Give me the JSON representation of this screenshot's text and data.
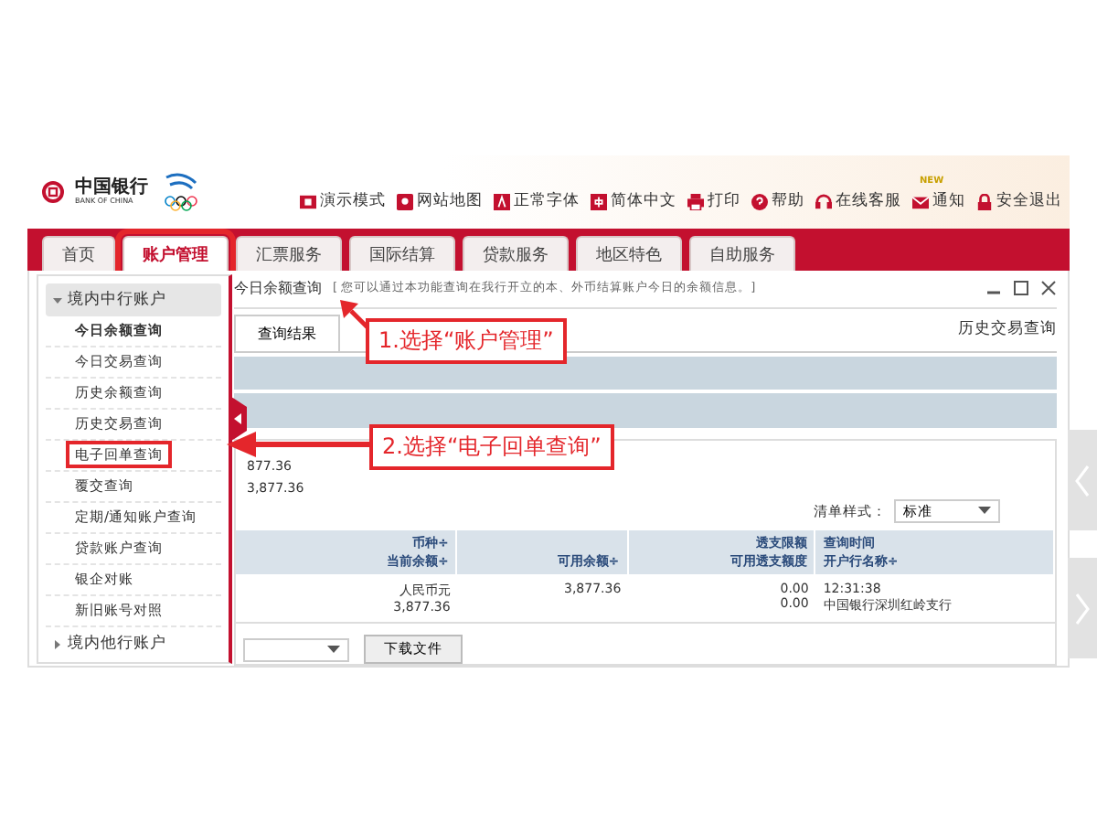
{
  "logo": {
    "name": "中国银行",
    "subtitle": "BANK OF CHINA"
  },
  "toolbar": [
    {
      "label": "演示模式",
      "kind": "demo"
    },
    {
      "label": "网站地图",
      "kind": "map"
    },
    {
      "label": "正常字体",
      "kind": "font"
    },
    {
      "label": "简体中文",
      "kind": "lang"
    },
    {
      "label": "打印",
      "kind": "print"
    },
    {
      "label": "帮助",
      "kind": "help"
    },
    {
      "label": "在线客服",
      "kind": "service"
    },
    {
      "label": "通知",
      "kind": "mail",
      "badge": "NEW"
    },
    {
      "label": "安全退出",
      "kind": "lock"
    }
  ],
  "nav_tabs": [
    {
      "label": "首页",
      "selected": false,
      "highlighted": false
    },
    {
      "label": "账户管理",
      "selected": true,
      "highlighted": true
    },
    {
      "label": "汇票服务",
      "selected": false,
      "highlighted": false
    },
    {
      "label": "国际结算",
      "selected": false,
      "highlighted": false
    },
    {
      "label": "贷款服务",
      "selected": false,
      "highlighted": false
    },
    {
      "label": "地区特色",
      "selected": false,
      "highlighted": false
    },
    {
      "label": "自助服务",
      "selected": false,
      "highlighted": false
    }
  ],
  "menu": [
    {
      "label": "境内中行账户",
      "expanded": true,
      "children": [
        {
          "label": "今日余额查询",
          "selected": true,
          "highlighted": false
        },
        {
          "label": "今日交易查询",
          "selected": false,
          "highlighted": false
        },
        {
          "label": "历史余额查询",
          "selected": false,
          "highlighted": false
        },
        {
          "label": "历史交易查询",
          "selected": false,
          "highlighted": false
        },
        {
          "label": "电子回单查询",
          "selected": false,
          "highlighted": true
        },
        {
          "label": "覆交查询",
          "selected": false,
          "highlighted": false
        },
        {
          "label": "定期/通知账户查询",
          "selected": false,
          "highlighted": false
        },
        {
          "label": "贷款账户查询",
          "selected": false,
          "highlighted": false
        },
        {
          "label": "银企对账",
          "selected": false,
          "highlighted": false
        },
        {
          "label": "新旧账号对照",
          "selected": false,
          "highlighted": false
        }
      ]
    },
    {
      "label": "境内他行账户",
      "expanded": false
    }
  ],
  "panel": {
    "breadcrumb": "今日余额查询",
    "note": "[ 您可以通过本功能查询在我行开立的本、外币结算账户今日的余额信息。]",
    "tab": "查询结果",
    "history_link": "历史交易查询",
    "summary": [
      "877.36",
      "3,877.36"
    ],
    "list_style": {
      "label": "清单样式：",
      "value": "标准"
    },
    "table": {
      "columns": [
        {
          "line_1": "币种÷",
          "line_2": "当前余额÷"
        },
        {
          "line_2": "可用余额÷"
        },
        {
          "line_1": "透支限额",
          "line_2": "可用透支额度"
        },
        {
          "line_1": "查询时间",
          "line_2": "开户行名称÷"
        }
      ],
      "rows": [
        [
          [
            "人民币元",
            "3,877.36"
          ],
          [
            "3,877.36"
          ],
          [
            "0.00",
            "0.00"
          ],
          [
            "12:31:38",
            "中国银行深圳红岭支行"
          ]
        ]
      ]
    },
    "download_button": "下载文件"
  },
  "annotations": [
    "1.选择“账户管理”",
    "2.选择“电子回单查询”"
  ]
}
